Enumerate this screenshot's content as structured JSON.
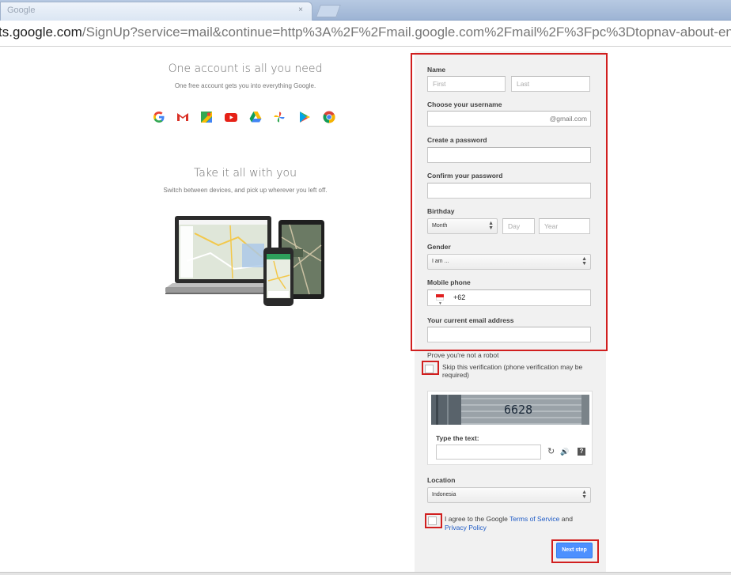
{
  "browser": {
    "tab_title": "Google",
    "tab_close": "×",
    "url_host": "ts.google.com",
    "url_path": "/SignUp?service=mail&continue=http%3A%2F%2Fmail.google.com%2Fmail%2F%3Fpc%3Dtopnav-about-en"
  },
  "promo": {
    "title1": "One account is all you need",
    "sub1": "One free account gets you into everything Google.",
    "app_icons": [
      "google-icon",
      "gmail-icon",
      "maps-icon",
      "youtube-icon",
      "drive-icon",
      "photos-icon",
      "play-icon",
      "chrome-icon"
    ],
    "title2": "Take it all with you",
    "sub2": "Switch between devices, and pick up wherever you left off."
  },
  "form": {
    "name_label": "Name",
    "first_placeholder": "First",
    "last_placeholder": "Last",
    "username_label": "Choose your username",
    "username_suffix": "@gmail.com",
    "password_label": "Create a password",
    "confirm_label": "Confirm your password",
    "birthday_label": "Birthday",
    "month_value": "Month",
    "day_placeholder": "Day",
    "year_placeholder": "Year",
    "gender_label": "Gender",
    "gender_value": "I am ...",
    "phone_label": "Mobile phone",
    "phone_value": "+62",
    "email_label": "Your current email address",
    "robot_title": "Prove you're not a robot",
    "skip_text": "Skip this verification (phone verification may be required)",
    "captcha_text": "6628",
    "captcha_label": "Type the text:",
    "refresh_icon": "↻",
    "audio_icon": "🔊",
    "help_icon": "?",
    "location_label": "Location",
    "location_value": "Indonesia",
    "agree_prefix": "I agree to the Google ",
    "terms_link": "Terms of Service",
    "agree_and": " and",
    "privacy_link": "Privacy Policy",
    "next_label": "Next step"
  },
  "colors": {
    "highlight": "#d11f1f",
    "button": "#4d90fe",
    "link": "#1f5bc6"
  }
}
